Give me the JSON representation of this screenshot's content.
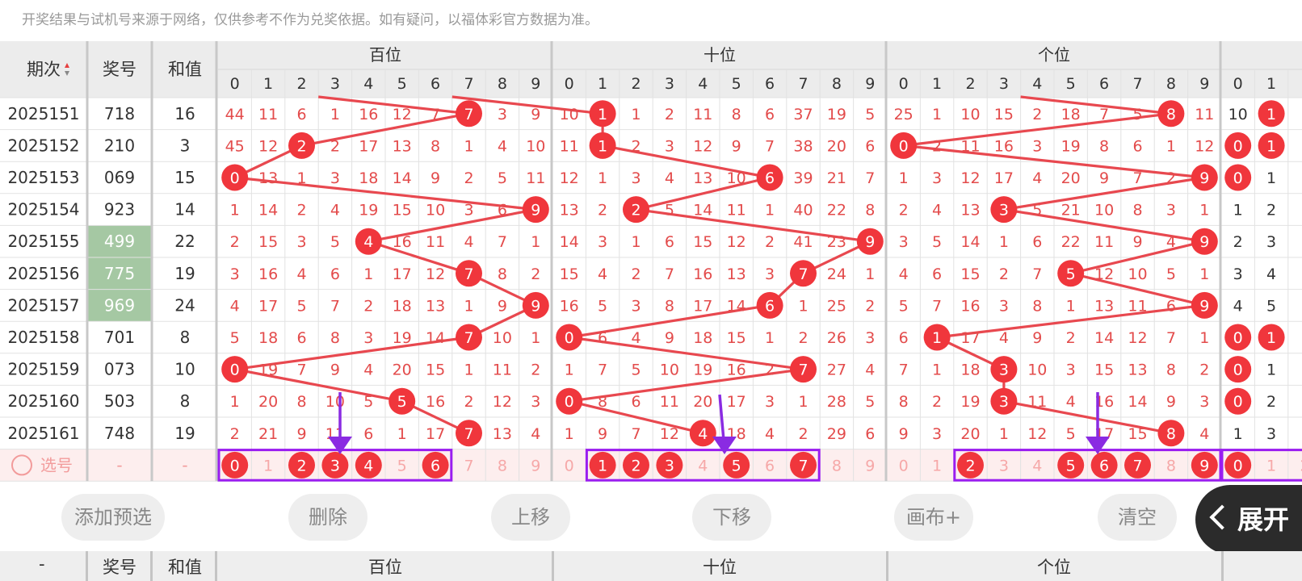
{
  "notice": "开奖结果与试机号来源于网络，仅供参考不作为兑奖依据。如有疑问，以福体彩官方数据为准。",
  "header": {
    "issue_label": "期次",
    "number_label": "奖号",
    "sum_label": "和值",
    "groups": [
      "百位",
      "十位",
      "个位"
    ],
    "digits": [
      "0",
      "1",
      "2",
      "3",
      "4",
      "5",
      "6",
      "7",
      "8",
      "9"
    ]
  },
  "rows": [
    {
      "issue": "2025151",
      "number": "718",
      "sum": "16",
      "hundreds": [
        "44",
        "11",
        "6",
        "1",
        "16",
        "12",
        "7",
        "7",
        "3",
        "9"
      ],
      "tens": [
        "10",
        "1",
        "1",
        "2",
        "11",
        "8",
        "6",
        "37",
        "19",
        "5"
      ],
      "units": [
        "25",
        "1",
        "10",
        "15",
        "2",
        "18",
        "7",
        "5",
        "8",
        "11"
      ],
      "extra": [
        "10",
        "1"
      ]
    },
    {
      "issue": "2025152",
      "number": "210",
      "sum": "3",
      "hundreds": [
        "45",
        "12",
        "2",
        "2",
        "17",
        "13",
        "8",
        "1",
        "4",
        "10"
      ],
      "tens": [
        "11",
        "1",
        "2",
        "3",
        "12",
        "9",
        "7",
        "38",
        "20",
        "6"
      ],
      "units": [
        "0",
        "2",
        "11",
        "16",
        "3",
        "19",
        "8",
        "6",
        "1",
        "12"
      ],
      "extra": [
        "0",
        "1"
      ]
    },
    {
      "issue": "2025153",
      "number": "069",
      "sum": "15",
      "hundreds": [
        "0",
        "13",
        "1",
        "3",
        "18",
        "14",
        "9",
        "2",
        "5",
        "11"
      ],
      "tens": [
        "12",
        "1",
        "3",
        "4",
        "13",
        "10",
        "6",
        "39",
        "21",
        "7"
      ],
      "units": [
        "1",
        "3",
        "12",
        "17",
        "4",
        "20",
        "9",
        "7",
        "2",
        "9"
      ],
      "extra": [
        "0",
        "1"
      ]
    },
    {
      "issue": "2025154",
      "number": "923",
      "sum": "14",
      "hundreds": [
        "1",
        "14",
        "2",
        "4",
        "19",
        "15",
        "10",
        "3",
        "6",
        "9"
      ],
      "tens": [
        "13",
        "2",
        "2",
        "5",
        "14",
        "11",
        "1",
        "40",
        "22",
        "8"
      ],
      "units": [
        "2",
        "4",
        "13",
        "3",
        "5",
        "21",
        "10",
        "8",
        "3",
        "1"
      ],
      "extra": [
        "1",
        "2"
      ]
    },
    {
      "issue": "2025155",
      "number": "499",
      "sum": "22",
      "hundreds": [
        "2",
        "15",
        "3",
        "5",
        "4",
        "16",
        "11",
        "4",
        "7",
        "1"
      ],
      "tens": [
        "14",
        "3",
        "1",
        "6",
        "15",
        "12",
        "2",
        "41",
        "23",
        "9"
      ],
      "units": [
        "3",
        "5",
        "14",
        "1",
        "6",
        "22",
        "11",
        "9",
        "4",
        "9"
      ],
      "extra": [
        "2",
        "3"
      ]
    },
    {
      "issue": "2025156",
      "number": "775",
      "sum": "19",
      "hundreds": [
        "3",
        "16",
        "4",
        "6",
        "1",
        "17",
        "12",
        "7",
        "8",
        "2"
      ],
      "tens": [
        "15",
        "4",
        "2",
        "7",
        "16",
        "13",
        "3",
        "7",
        "24",
        "1"
      ],
      "units": [
        "4",
        "6",
        "15",
        "2",
        "7",
        "5",
        "12",
        "10",
        "5",
        "1"
      ],
      "extra": [
        "3",
        "4"
      ]
    },
    {
      "issue": "2025157",
      "number": "969",
      "sum": "24",
      "hundreds": [
        "4",
        "17",
        "5",
        "7",
        "2",
        "18",
        "13",
        "1",
        "9",
        "9"
      ],
      "tens": [
        "16",
        "5",
        "3",
        "8",
        "17",
        "14",
        "6",
        "1",
        "25",
        "2"
      ],
      "units": [
        "5",
        "7",
        "16",
        "3",
        "8",
        "1",
        "13",
        "11",
        "6",
        "9"
      ],
      "extra": [
        "4",
        "5"
      ]
    },
    {
      "issue": "2025158",
      "number": "701",
      "sum": "8",
      "hundreds": [
        "5",
        "18",
        "6",
        "8",
        "3",
        "19",
        "14",
        "7",
        "10",
        "1"
      ],
      "tens": [
        "0",
        "6",
        "4",
        "9",
        "18",
        "15",
        "1",
        "2",
        "26",
        "3"
      ],
      "units": [
        "6",
        "1",
        "17",
        "4",
        "9",
        "2",
        "14",
        "12",
        "7",
        "1"
      ],
      "extra": [
        "0",
        "1"
      ]
    },
    {
      "issue": "2025159",
      "number": "073",
      "sum": "10",
      "hundreds": [
        "0",
        "19",
        "7",
        "9",
        "4",
        "20",
        "15",
        "1",
        "11",
        "2"
      ],
      "tens": [
        "1",
        "7",
        "5",
        "10",
        "19",
        "16",
        "2",
        "7",
        "27",
        "4"
      ],
      "units": [
        "7",
        "1",
        "18",
        "3",
        "10",
        "3",
        "15",
        "13",
        "8",
        "2"
      ],
      "extra": [
        "0",
        "1"
      ]
    },
    {
      "issue": "2025160",
      "number": "503",
      "sum": "8",
      "hundreds": [
        "1",
        "20",
        "8",
        "10",
        "5",
        "5",
        "16",
        "2",
        "12",
        "3"
      ],
      "tens": [
        "0",
        "8",
        "6",
        "11",
        "20",
        "17",
        "3",
        "1",
        "28",
        "5"
      ],
      "units": [
        "8",
        "2",
        "19",
        "3",
        "11",
        "4",
        "16",
        "14",
        "9",
        "3"
      ],
      "extra": [
        "0",
        "2"
      ]
    },
    {
      "issue": "2025161",
      "number": "748",
      "sum": "19",
      "hundreds": [
        "2",
        "21",
        "9",
        "11",
        "6",
        "1",
        "17",
        "7",
        "13",
        "4"
      ],
      "tens": [
        "1",
        "9",
        "7",
        "12",
        "4",
        "18",
        "4",
        "2",
        "29",
        "6"
      ],
      "units": [
        "9",
        "3",
        "20",
        "1",
        "12",
        "5",
        "17",
        "15",
        "8",
        "4"
      ],
      "extra": [
        "1",
        "3"
      ]
    }
  ],
  "select_row": {
    "label": "选号",
    "number": "-",
    "sum": "-",
    "hundreds_selected": [
      "0",
      "2",
      "3",
      "4",
      "6"
    ],
    "tens_selected": [
      "1",
      "2",
      "3",
      "5",
      "7"
    ],
    "units_selected": [
      "2",
      "5",
      "6",
      "7",
      "9"
    ],
    "extra_selected": [
      "0"
    ]
  },
  "actions": {
    "add": "添加预选",
    "delete": "删除",
    "up": "上移",
    "down": "下移",
    "canvas": "画布+",
    "clear": "清空",
    "expand": "展开"
  },
  "bottom_header": {
    "first": "-",
    "number_label": "奖号",
    "sum_label": "和值",
    "groups": [
      "百位",
      "十位",
      "个位"
    ]
  },
  "colors": {
    "ball": "#f0363c",
    "miss_text": "#e34b4b",
    "line": "#e8484f",
    "highlight": "#a5c8a3",
    "selection_box": "#9a1df0",
    "arrow": "#8a2be2",
    "select_row_bg": "#fdeeee"
  }
}
